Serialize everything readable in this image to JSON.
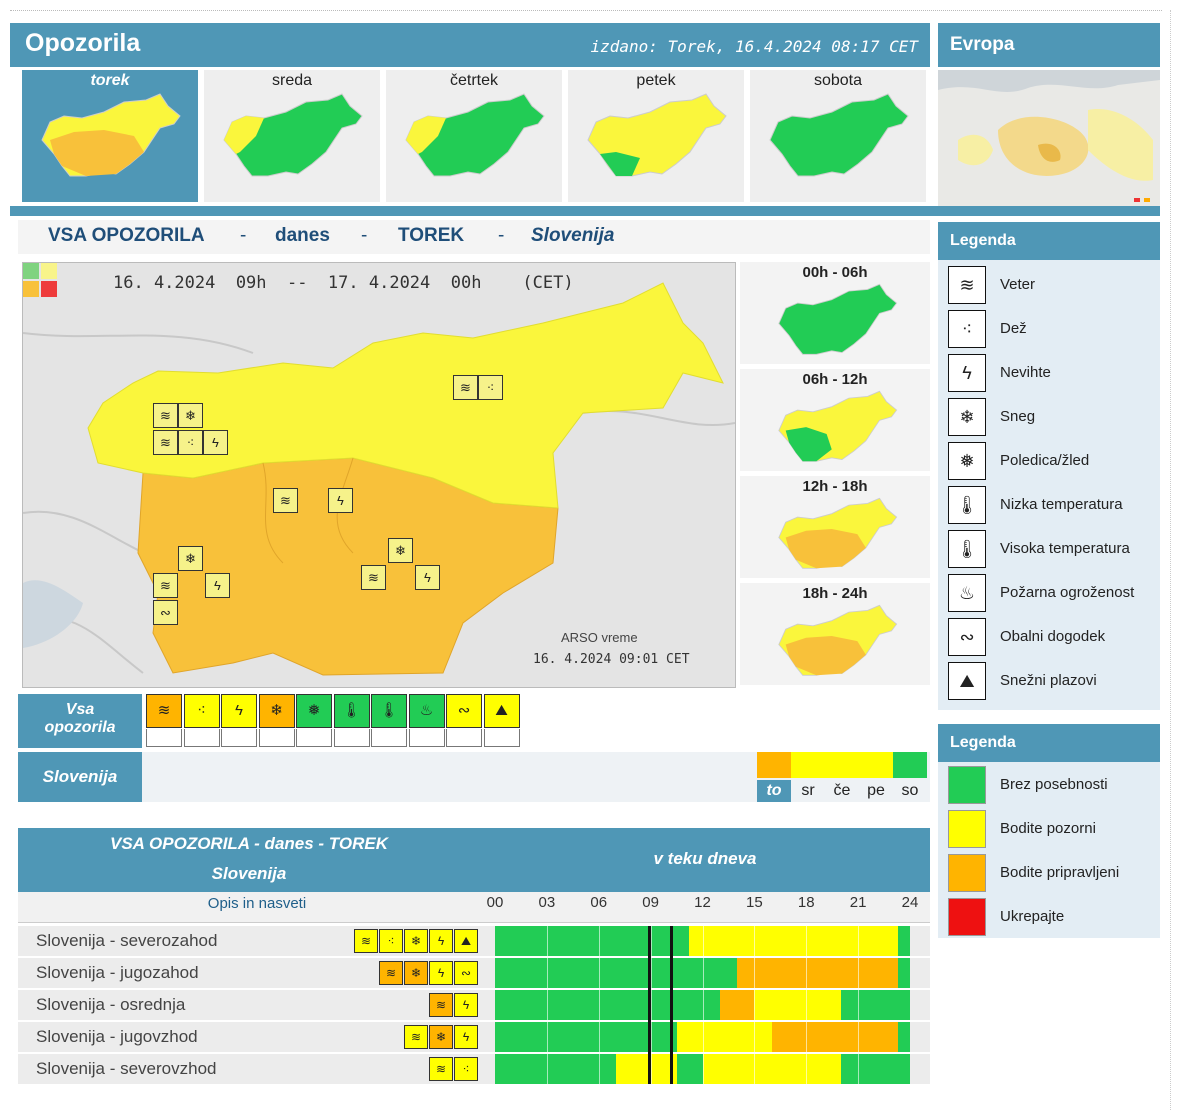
{
  "header": {
    "title": "Opozorila",
    "issued": "izdano: Torek, 16.4.2024 08:17 CET",
    "europe": "Evropa"
  },
  "days": [
    {
      "label": "torek",
      "active": true,
      "level": "orange"
    },
    {
      "label": "sreda",
      "active": false,
      "level": "yellow"
    },
    {
      "label": "četrtek",
      "active": false,
      "level": "yellow"
    },
    {
      "label": "petek",
      "active": false,
      "level": "yellow"
    },
    {
      "label": "sobota",
      "active": false,
      "level": "green"
    }
  ],
  "section_title": {
    "all": "VSA OPOZORILA",
    "sep": "-",
    "today": "danes",
    "day": "TOREK",
    "region": "Slovenija"
  },
  "map": {
    "title": "16. 4.2024  09h  --  17. 4.2024  00h    (CET)",
    "credit": "ARSO vreme",
    "timestamp": "16. 4.2024  09:01 CET"
  },
  "periods": [
    {
      "label": "00h - 06h",
      "level": "green"
    },
    {
      "label": "06h - 12h",
      "level": "yellow"
    },
    {
      "label": "12h - 18h",
      "level": "orange"
    },
    {
      "label": "18h - 24h",
      "level": "orange"
    }
  ],
  "legend_types": {
    "header": "Legenda",
    "items": [
      {
        "label": "Veter",
        "icon": "wind-icon"
      },
      {
        "label": "Dež",
        "icon": "rain-icon"
      },
      {
        "label": "Nevihte",
        "icon": "lightning-icon"
      },
      {
        "label": "Sneg",
        "icon": "snow-icon"
      },
      {
        "label": "Poledica/žled",
        "icon": "ice-icon"
      },
      {
        "label": "Nizka temperatura",
        "icon": "low-temperature-icon"
      },
      {
        "label": "Visoka temperatura",
        "icon": "high-temperature-icon"
      },
      {
        "label": "Požarna ogroženost",
        "icon": "fire-icon"
      },
      {
        "label": "Obalni dogodek",
        "icon": "wave-icon"
      },
      {
        "label": "Snežni plazovi",
        "icon": "avalanche-icon"
      }
    ]
  },
  "legend_levels": {
    "header": "Legenda",
    "items": [
      {
        "label": "Brez posebnosti",
        "color": "#22cc55"
      },
      {
        "label": "Bodite pozorni",
        "color": "#ffff00"
      },
      {
        "label": "Bodite pripravljeni",
        "color": "#ffb400"
      },
      {
        "label": "Ukrepajte",
        "color": "#ee1111"
      }
    ]
  },
  "filters": {
    "all_label_1": "Vsa",
    "all_label_2": "opozorila",
    "region_label": "Slovenija",
    "icons": [
      {
        "icon": "wind-icon",
        "bg": "#ffb400"
      },
      {
        "icon": "rain-icon",
        "bg": "#ffff00"
      },
      {
        "icon": "lightning-icon",
        "bg": "#ffff00"
      },
      {
        "icon": "snow-icon",
        "bg": "#ffb400"
      },
      {
        "icon": "ice-icon",
        "bg": "#22cc55"
      },
      {
        "icon": "low-temperature-icon",
        "bg": "#22cc55"
      },
      {
        "icon": "high-temperature-icon",
        "bg": "#22cc55"
      },
      {
        "icon": "fire-icon",
        "bg": "#22cc55"
      },
      {
        "icon": "wave-icon",
        "bg": "#ffff00"
      },
      {
        "icon": "avalanche-icon",
        "bg": "#ffff00"
      }
    ],
    "day_switch": [
      {
        "label": "to",
        "color": "#ffb400",
        "active": true
      },
      {
        "label": "sr",
        "color": "#ffff00",
        "active": false
      },
      {
        "label": "če",
        "color": "#ffff00",
        "active": false
      },
      {
        "label": "pe",
        "color": "#ffff00",
        "active": false
      },
      {
        "label": "so",
        "color": "#22cc55",
        "active": false
      }
    ]
  },
  "table": {
    "title_line1": "VSA OPOZORILA - danes - TOREK",
    "title_line2": "Slovenija",
    "timeline_title": "v teku dneva",
    "opis": "Opis in nasveti",
    "hours": [
      "00",
      "03",
      "06",
      "09",
      "12",
      "15",
      "18",
      "21",
      "24"
    ],
    "rows": [
      {
        "name": "Slovenija - severozahod",
        "icons": [
          "wind-icon",
          "rain-icon",
          "snow-icon",
          "lightning-icon",
          "avalanche-icon"
        ],
        "timeline": [
          "g",
          "g",
          "g",
          "g",
          "g",
          "g",
          "g",
          "g",
          "g",
          "g",
          "g",
          "g",
          "g",
          "g",
          "g",
          "g",
          "g",
          "g",
          "g",
          "g",
          "g",
          "g",
          "g",
          "g",
          "g",
          "g",
          "g",
          "g",
          "g",
          "g",
          "g",
          "g",
          "g",
          "g",
          "g",
          "g",
          "g",
          "g",
          "g",
          "g",
          "g",
          "g",
          "g",
          "g",
          "g",
          "g",
          "g",
          "g",
          "g",
          "g",
          "g",
          "g",
          "g",
          "g",
          "g",
          "g",
          "g",
          "g",
          "g",
          "g"
        ]
      }
    ]
  }
}
